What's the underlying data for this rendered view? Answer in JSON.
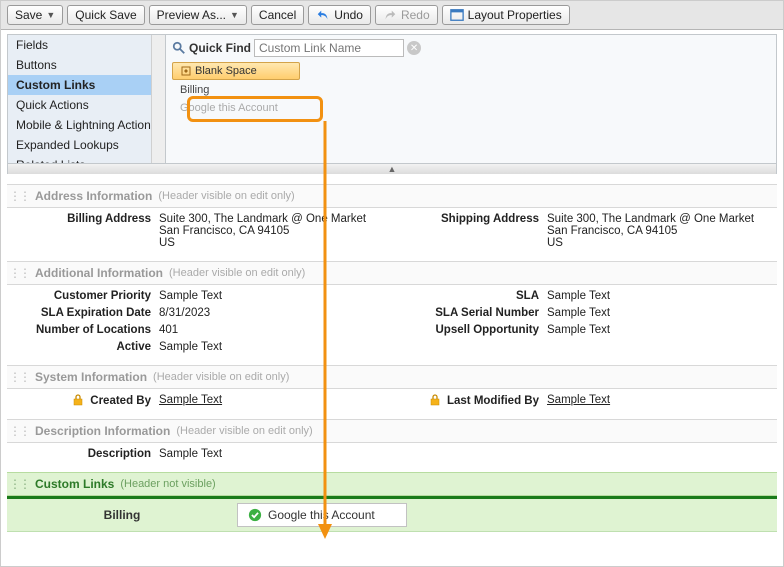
{
  "toolbar": {
    "save": "Save",
    "quick_save": "Quick Save",
    "preview_as": "Preview As...",
    "cancel": "Cancel",
    "undo": "Undo",
    "redo": "Redo",
    "layout_properties": "Layout Properties"
  },
  "palette": {
    "categories": [
      {
        "label": "Fields"
      },
      {
        "label": "Buttons"
      },
      {
        "label": "Custom Links",
        "selected": true
      },
      {
        "label": "Quick Actions"
      },
      {
        "label": "Mobile & Lightning Actions"
      },
      {
        "label": "Expanded Lookups"
      },
      {
        "label": "Related Lists"
      }
    ],
    "quick_find_label": "Quick Find",
    "quick_find_placeholder": "Custom Link Name",
    "items": {
      "blank": "Blank Space",
      "billing": "Billing",
      "google": "Google this Account"
    }
  },
  "sections": {
    "address": {
      "title": "Address Information",
      "hint": "(Header visible on edit only)",
      "billing_label": "Billing Address",
      "billing_value": "Suite 300, The Landmark @ One Market\nSan Francisco, CA 94105\nUS",
      "shipping_label": "Shipping Address",
      "shipping_value": "Suite 300, The Landmark @ One Market\nSan Francisco, CA 94105\nUS"
    },
    "additional": {
      "title": "Additional Information",
      "hint": "(Header visible on edit only)",
      "fields": [
        {
          "l": "Customer Priority",
          "v": "Sample Text",
          "r": "SLA",
          "rv": "Sample Text"
        },
        {
          "l": "SLA Expiration Date",
          "v": "8/31/2023",
          "r": "SLA Serial Number",
          "rv": "Sample Text"
        },
        {
          "l": "Number of Locations",
          "v": "401",
          "r": "Upsell Opportunity",
          "rv": "Sample Text"
        },
        {
          "l": "Active",
          "v": "Sample Text",
          "r": "",
          "rv": ""
        }
      ]
    },
    "system": {
      "title": "System Information",
      "hint": "(Header visible on edit only)",
      "created_label": "Created By",
      "created_value": "Sample Text",
      "modified_label": "Last Modified By",
      "modified_value": "Sample Text"
    },
    "description": {
      "title": "Description Information",
      "hint": "(Header visible on edit only)",
      "label": "Description",
      "value": "Sample Text"
    },
    "custom_links": {
      "title": "Custom Links",
      "hint": "(Header not visible)",
      "billing": "Billing",
      "google": "Google this Account"
    }
  }
}
